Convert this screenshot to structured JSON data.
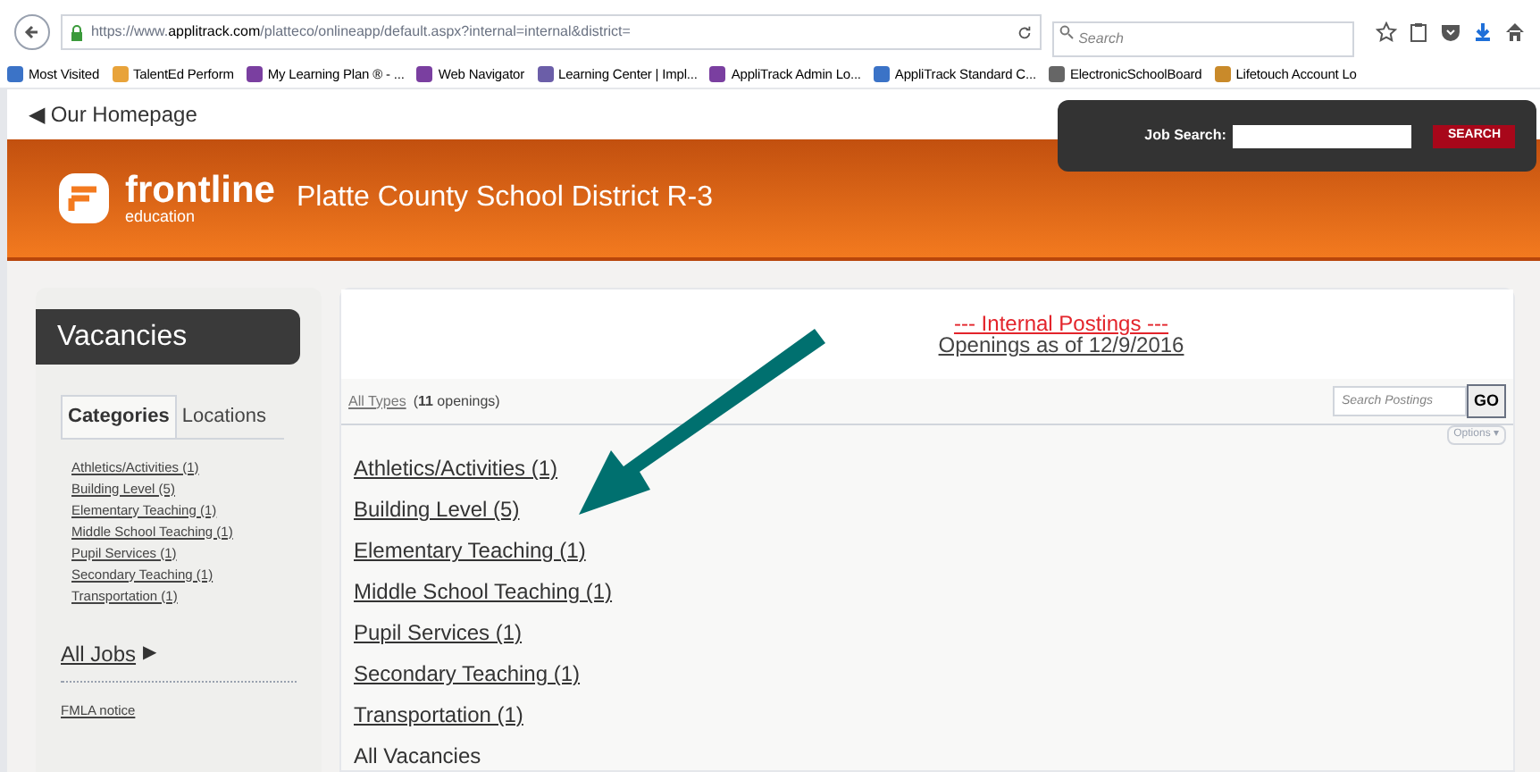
{
  "browser": {
    "url_prefix": "https://www.",
    "url_domain": "applitrack.com",
    "url_rest": "/platteco/onlineapp/default.aspx?internal=internal&district=",
    "search_placeholder": "Search"
  },
  "bookmarks": [
    {
      "label": "Most Visited"
    },
    {
      "label": "TalentEd Perform"
    },
    {
      "label": "My Learning Plan ® - ..."
    },
    {
      "label": "Web Navigator"
    },
    {
      "label": "Learning Center | Impl..."
    },
    {
      "label": "AppliTrack Admin Lo..."
    },
    {
      "label": "AppliTrack Standard C..."
    },
    {
      "label": "ElectronicSchoolBoard"
    },
    {
      "label": "Lifetouch Account Lo"
    }
  ],
  "homepage_link": "◀ Our Homepage",
  "job_search": {
    "label": "Job Search:",
    "button": "SEARCH"
  },
  "header": {
    "logo_word": "frontline",
    "logo_sub": "education",
    "district": "Platte County School District R-3"
  },
  "sidebar": {
    "title": "Vacancies",
    "tabs": [
      {
        "label": "Categories",
        "selected": true
      },
      {
        "label": "Locations",
        "selected": false
      }
    ],
    "items": [
      "Athletics/Activities (1)",
      "Building Level (5)",
      "Elementary Teaching (1)",
      "Middle School Teaching (1)",
      "Pupil Services (1)",
      "Secondary Teaching (1)",
      "Transportation (1)"
    ],
    "all_jobs": "All Jobs",
    "all_jobs_arrow": "▶",
    "notice": "FMLA notice"
  },
  "main": {
    "heading": "--- Internal Postings ---",
    "subheading": "Openings as of 12/9/2016",
    "filter_link": "All Types",
    "count": "(**11** openings)",
    "search_placeholder": "Search Postings",
    "go": "GO",
    "options": "Options ▾",
    "categories": [
      "Athletics/Activities (1)",
      "Building Level (5)",
      "Elementary Teaching (1)",
      "Middle School Teaching (1)",
      "Pupil Services (1)",
      "Secondary Teaching (1)",
      "Transportation (1)"
    ],
    "all_vacancies": "All Vacancies"
  }
}
